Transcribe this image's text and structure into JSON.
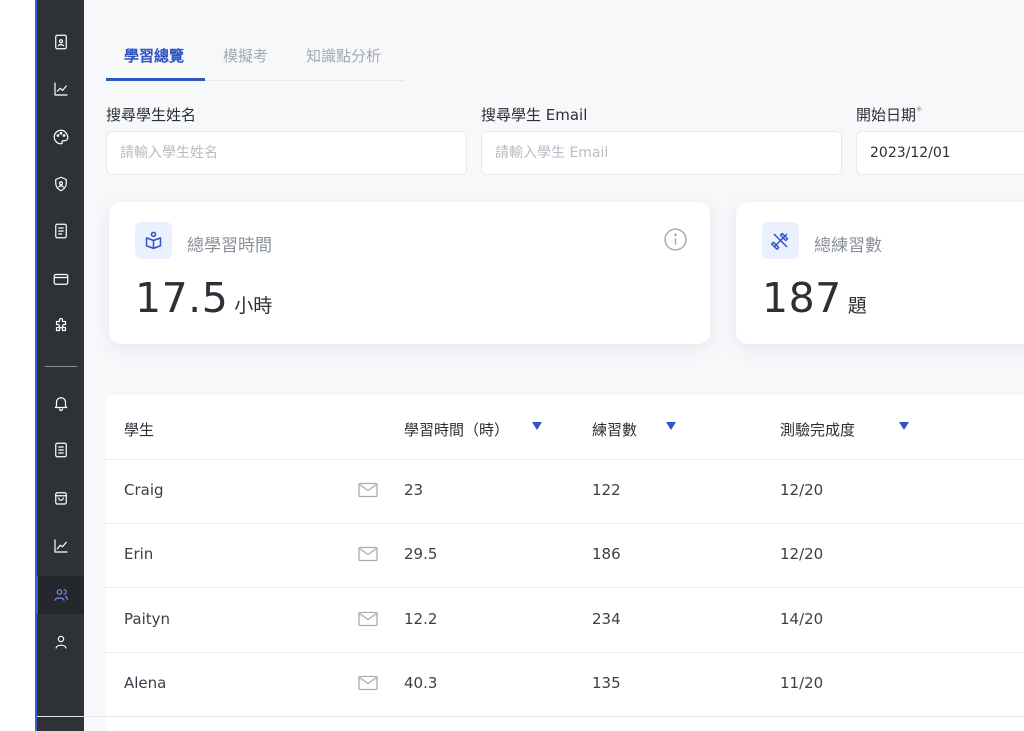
{
  "sidebar": {
    "items": [
      {
        "icon": "document-icon",
        "active": false
      },
      {
        "icon": "line-chart-icon",
        "active": false
      },
      {
        "icon": "palette-icon",
        "active": false
      },
      {
        "icon": "shield-icon",
        "active": false
      },
      {
        "icon": "file-text-icon",
        "active": false
      },
      {
        "icon": "credit-card-icon",
        "active": false
      },
      {
        "icon": "puzzle-icon",
        "active": false
      },
      {
        "icon": "bell-icon",
        "active": false
      },
      {
        "icon": "notes-icon",
        "active": false
      },
      {
        "icon": "bag-icon",
        "active": false
      },
      {
        "icon": "trend-chart-icon",
        "active": false
      },
      {
        "icon": "users-icon",
        "active": true
      },
      {
        "icon": "user-icon",
        "active": false
      }
    ]
  },
  "tabs": [
    {
      "label": "學習總覽",
      "active": true
    },
    {
      "label": "模擬考",
      "active": false
    },
    {
      "label": "知識點分析",
      "active": false
    }
  ],
  "filters": {
    "name": {
      "label": "搜尋學生姓名",
      "placeholder": "請輸入學生姓名",
      "value": ""
    },
    "email": {
      "label": "搜尋學生 Email",
      "placeholder": "請輸入學生 Email",
      "value": ""
    },
    "start_date": {
      "label": "開始日期",
      "required_mark": "*",
      "value": "2023/12/01"
    }
  },
  "stats": [
    {
      "icon": "book-reader-icon",
      "title": "總學習時間",
      "value": "17.5",
      "unit": "小時",
      "has_info": true
    },
    {
      "icon": "tools-icon",
      "title": "總練習數",
      "value": "187",
      "unit": "題",
      "has_info": false
    }
  ],
  "table": {
    "columns": [
      {
        "label": "學生",
        "sortable": false
      },
      {
        "label": "學習時間（時）",
        "sortable": true
      },
      {
        "label": "練習數",
        "sortable": true
      },
      {
        "label": "測驗完成度",
        "sortable": true
      }
    ],
    "rows": [
      {
        "name": "Craig",
        "hours": "23",
        "practice": "122",
        "completion": "12/20"
      },
      {
        "name": "Erin",
        "hours": "29.5",
        "practice": "186",
        "completion": "12/20"
      },
      {
        "name": "Paityn",
        "hours": "12.2",
        "practice": "234",
        "completion": "14/20"
      },
      {
        "name": "Alena",
        "hours": "40.3",
        "practice": "135",
        "completion": "11/20"
      }
    ]
  },
  "colors": {
    "accent": "#2e54c7",
    "sidebar_bg": "#2e3236",
    "page_bg": "#f7f8fa"
  }
}
